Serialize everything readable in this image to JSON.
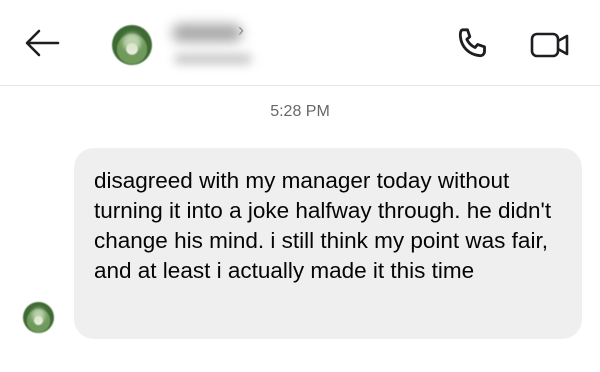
{
  "header": {
    "contact_name": "",
    "contact_status": "",
    "chevron": "›",
    "icons": {
      "back": "back-arrow-icon",
      "call": "phone-icon",
      "video": "video-camera-icon"
    }
  },
  "conversation": {
    "timestamp": "5:28 PM",
    "messages": [
      {
        "text": "disagreed with my manager today without turning it into a joke halfway through. he didn't change his mind. i still think my point was fair, and at least i actually made it this time"
      }
    ]
  },
  "colors": {
    "bubble": "#efefef",
    "timestamp": "#65676b",
    "text": "#050505",
    "icon": "#1c1e21"
  }
}
